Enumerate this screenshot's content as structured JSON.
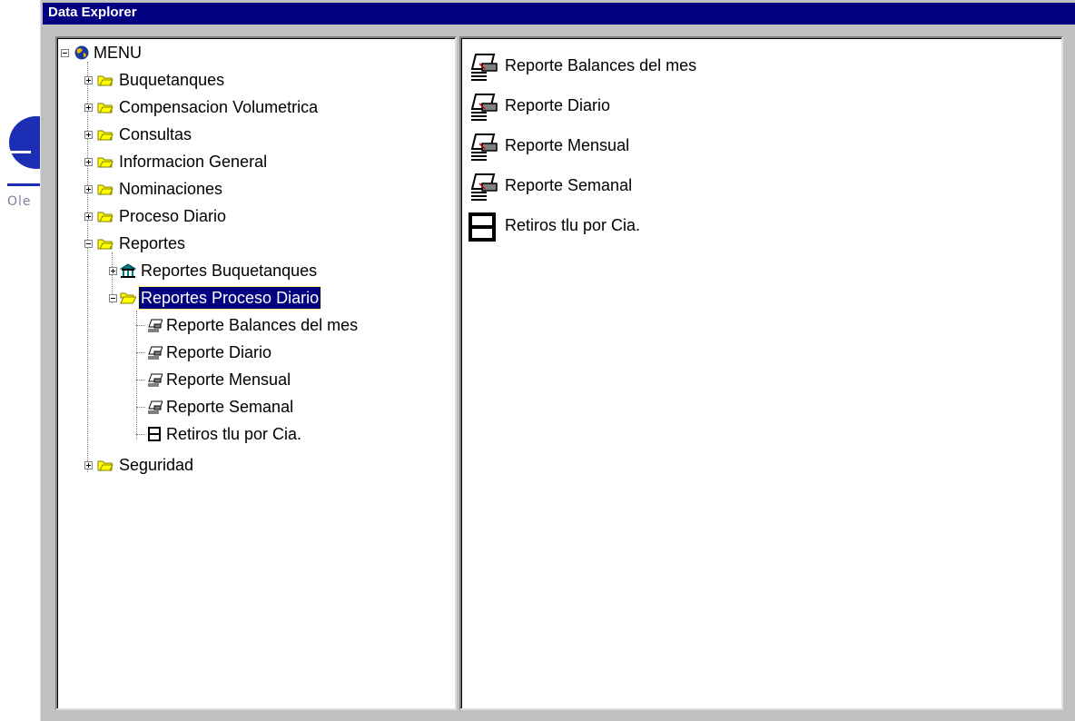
{
  "window": {
    "title": "Data Explorer"
  },
  "background_app": {
    "logo_text": "Ole"
  },
  "tree": {
    "root": {
      "label": "MENU",
      "icon": "globe-icon",
      "expanded": true
    },
    "items": [
      {
        "label": "Buquetanques",
        "icon": "folder-icon",
        "expanded": false
      },
      {
        "label": "Compensacion Volumetrica",
        "icon": "folder-icon",
        "expanded": false
      },
      {
        "label": "Consultas",
        "icon": "folder-icon",
        "expanded": false
      },
      {
        "label": "Informacion General",
        "icon": "folder-icon",
        "expanded": false
      },
      {
        "label": "Nominaciones",
        "icon": "folder-icon",
        "expanded": false
      },
      {
        "label": "Proceso Diario",
        "icon": "folder-icon",
        "expanded": false
      },
      {
        "label": "Reportes",
        "icon": "folder-icon",
        "expanded": true,
        "children": [
          {
            "label": "Reportes Buquetanques",
            "icon": "building-icon",
            "expanded": false
          },
          {
            "label": "Reportes Proceso Diario",
            "icon": "open-folder-icon",
            "expanded": true,
            "selected": true,
            "children": [
              {
                "label": "Reporte Balances del mes",
                "icon": "report-icon"
              },
              {
                "label": "Reporte Diario",
                "icon": "report-icon"
              },
              {
                "label": "Reporte Mensual",
                "icon": "report-icon"
              },
              {
                "label": "Reporte Semanal",
                "icon": "report-icon"
              },
              {
                "label": "Retiros tlu por Cia.",
                "icon": "grid-report-icon"
              }
            ]
          }
        ]
      },
      {
        "label": "Seguridad",
        "icon": "folder-icon",
        "expanded": false
      }
    ]
  },
  "list": {
    "items": [
      {
        "label": "Reporte Balances del mes",
        "icon": "report-icon"
      },
      {
        "label": "Reporte Diario",
        "icon": "report-icon"
      },
      {
        "label": "Reporte Mensual",
        "icon": "report-icon"
      },
      {
        "label": "Reporte Semanal",
        "icon": "report-icon"
      },
      {
        "label": "Retiros tlu por Cia.",
        "icon": "grid-report-icon"
      }
    ]
  },
  "colors": {
    "titlebar": "#000080",
    "selection": "#000080",
    "window_face": "#c0c0c0",
    "folder_yellow": "#ffff00",
    "logo_blue": "#1c2fb4"
  }
}
